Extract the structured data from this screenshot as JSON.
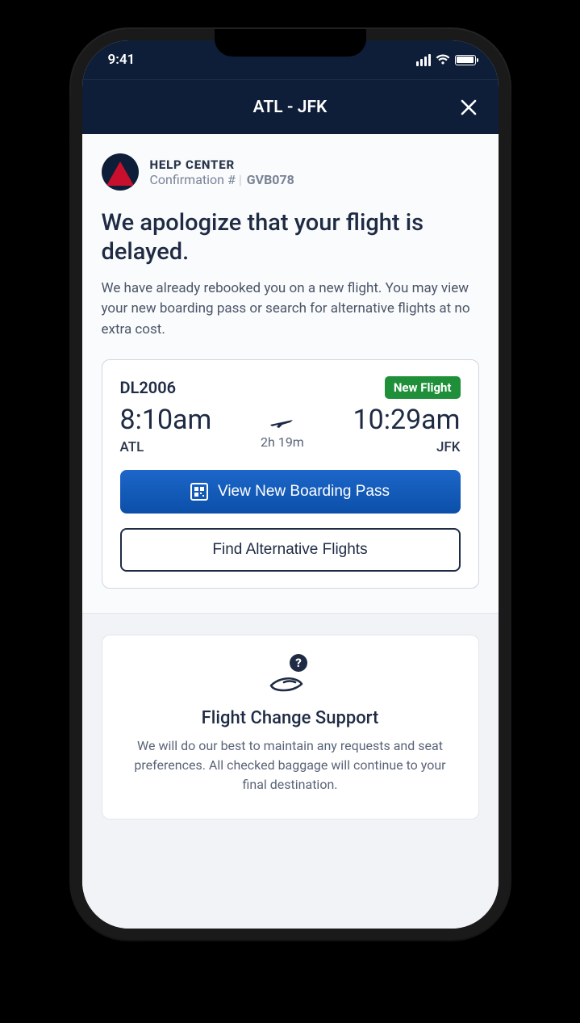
{
  "status_bar": {
    "time": "9:41"
  },
  "header": {
    "route": "ATL - JFK"
  },
  "help_center": {
    "label": "HELP CENTER",
    "confirmation_label": "Confirmation #",
    "confirmation_number": "GVB078"
  },
  "message": {
    "headline": "We apologize that your flight is delayed.",
    "subtext": "We have already rebooked you on a new flight. You may view your new boarding pass or search for alternative flights at no extra cost."
  },
  "flight_card": {
    "flight_number": "DL2006",
    "badge": "New Flight",
    "depart_time": "8:10am",
    "depart_code": "ATL",
    "duration": "2h 19m",
    "arrive_time": "10:29am",
    "arrive_code": "JFK"
  },
  "actions": {
    "boarding_pass": "View New Boarding Pass",
    "alternative": "Find Alternative Flights"
  },
  "support": {
    "title": "Flight Change Support",
    "text": "We will do our best to maintain any requests and seat preferences. All checked baggage will continue to your final destination."
  },
  "colors": {
    "navy": "#0e1e38",
    "red": "#c8102e",
    "green": "#1f8f3a",
    "blue": "#0b5cc0"
  }
}
